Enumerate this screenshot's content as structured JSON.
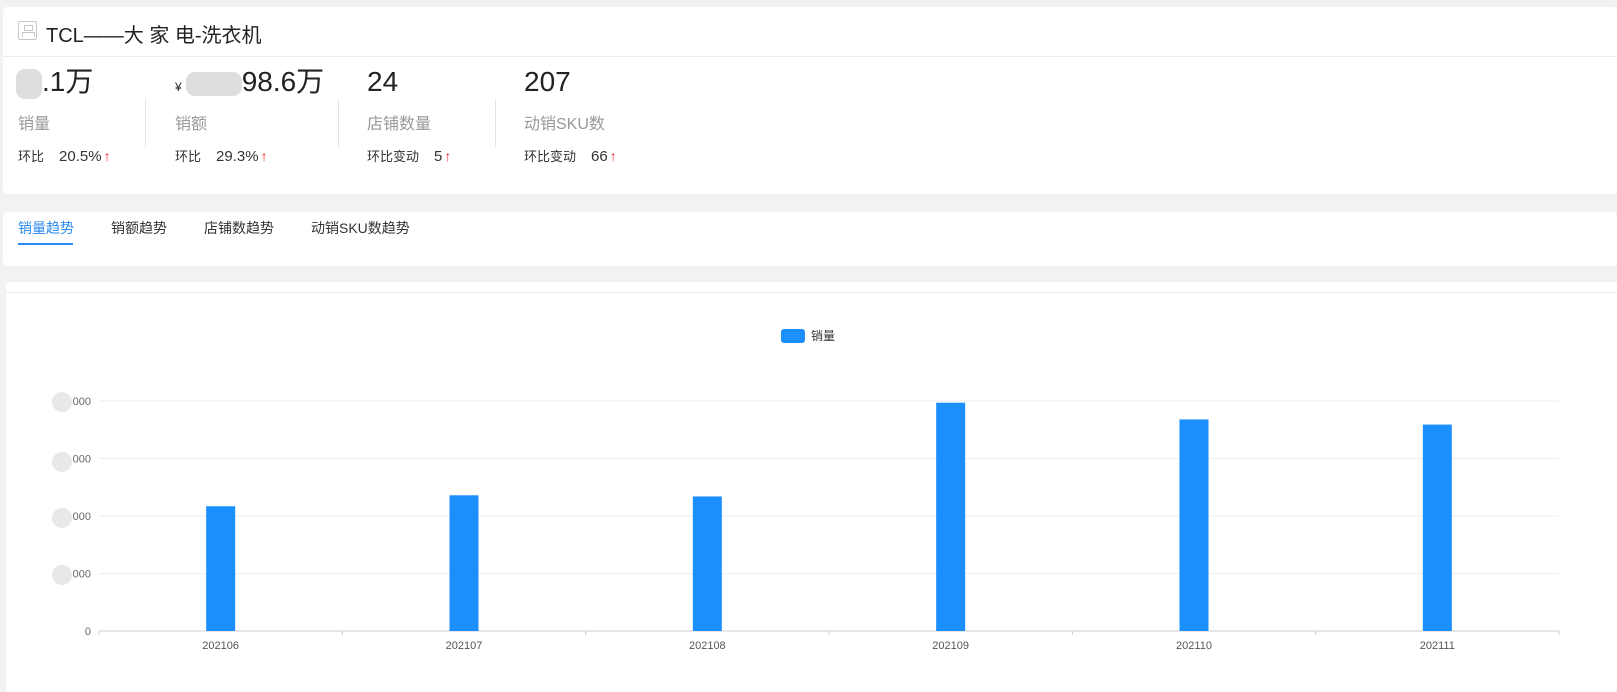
{
  "header": {
    "title": "TCL——大 家 电-洗衣机"
  },
  "metrics": [
    {
      "value": ".1万",
      "currency": "",
      "label": "销量",
      "change_label": "环比",
      "change_value": "20.5%",
      "arrow": "↑"
    },
    {
      "value": "98.6万",
      "currency": "¥",
      "label": "销额",
      "change_label": "环比",
      "change_value": "29.3%",
      "arrow": "↑"
    },
    {
      "value": "24",
      "currency": "",
      "label": "店铺数量",
      "change_label": "环比变动",
      "change_value": "5",
      "arrow": "↑"
    },
    {
      "value": "207",
      "currency": "",
      "label": "动销SKU数",
      "change_label": "环比变动",
      "change_value": "66",
      "arrow": "↑"
    }
  ],
  "tabs": [
    {
      "label": "销量趋势",
      "active": true
    },
    {
      "label": "销额趋势",
      "active": false
    },
    {
      "label": "店铺数趋势",
      "active": false
    },
    {
      "label": "动销SKU数趋势",
      "active": false
    }
  ],
  "colors": {
    "accent": "#2a8bf2",
    "bar": "#1a8ffd",
    "up_arrow": "#f5222d"
  },
  "chart_data": {
    "type": "bar",
    "legend": "销量",
    "categories": [
      "202106",
      "202107",
      "202108",
      "202109",
      "202110",
      "202111"
    ],
    "series": [
      {
        "name": "销量",
        "values": [
          21700,
          23600,
          23400,
          39700,
          36800,
          35900
        ]
      }
    ],
    "ylim": [
      0,
      40000
    ],
    "yticks": [
      0,
      10000,
      20000,
      30000,
      40000
    ],
    "ytick_labels_visible": [
      "0",
      "000",
      "000",
      "000",
      "000"
    ],
    "grid": true,
    "legend_position": "top-center"
  }
}
